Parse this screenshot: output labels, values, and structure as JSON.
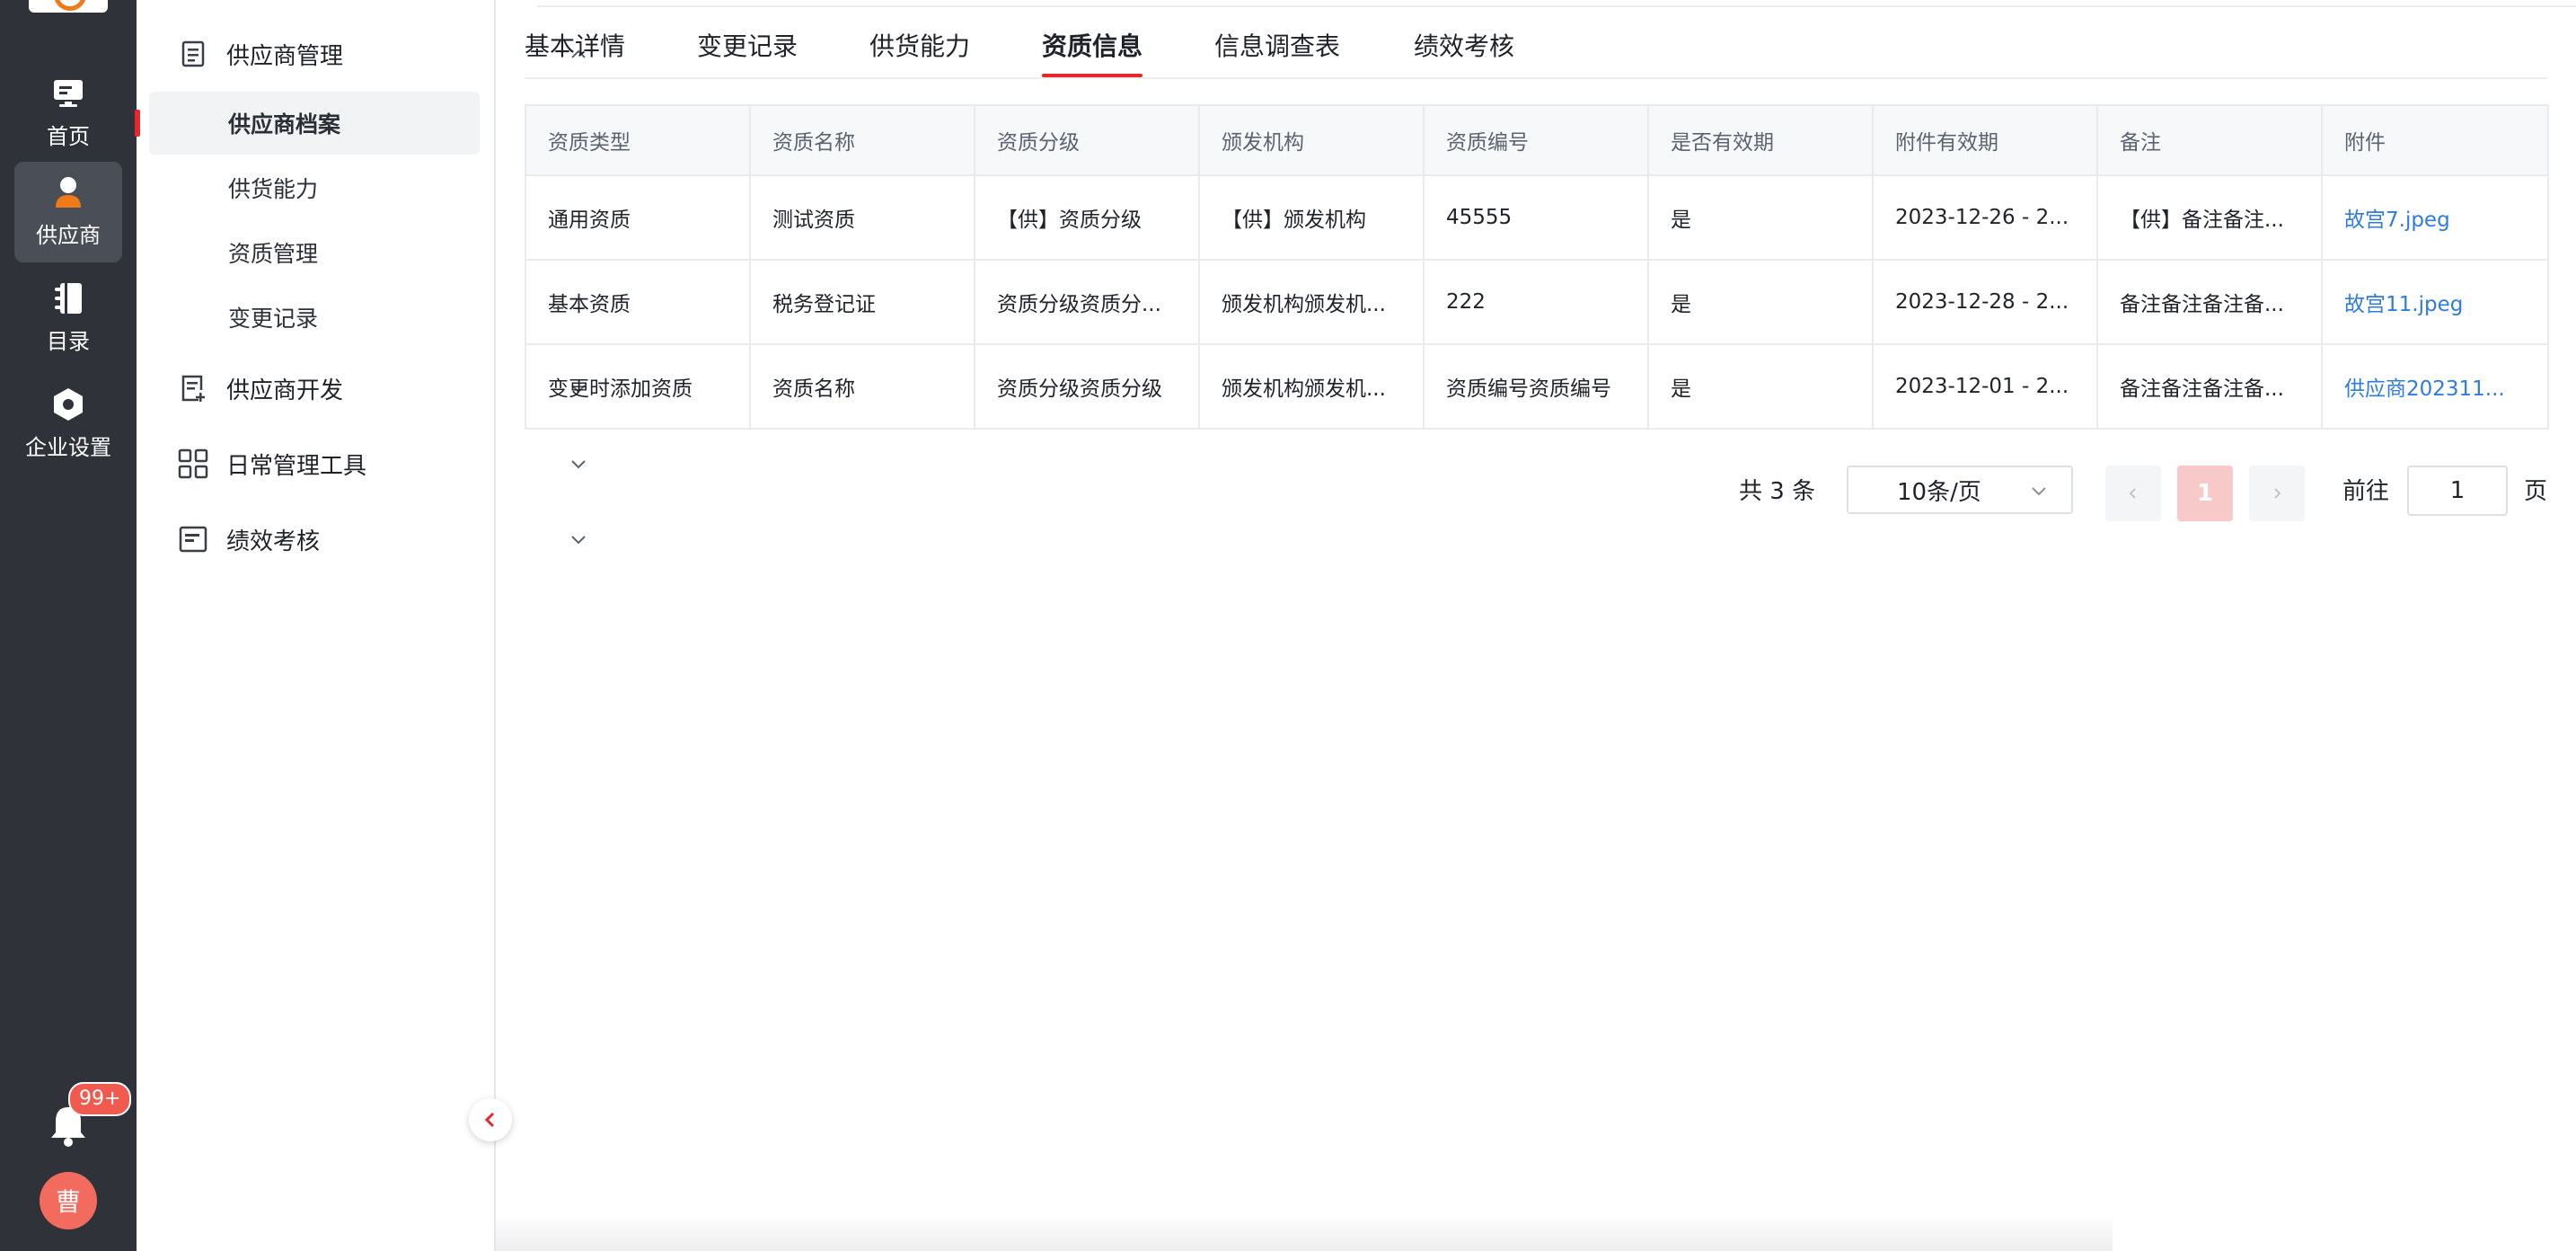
{
  "rail": {
    "items": [
      {
        "label": "首页",
        "icon": "monitor-icon"
      },
      {
        "label": "供应商",
        "icon": "person-icon"
      },
      {
        "label": "目录",
        "icon": "book-icon"
      },
      {
        "label": "企业设置",
        "icon": "gear-icon"
      }
    ],
    "notification_badge": "99+",
    "avatar_text": "曹"
  },
  "submenu": {
    "groups": [
      {
        "label": "供应商管理",
        "icon": "document-icon"
      },
      {
        "label": "供应商开发",
        "icon": "document-add-icon"
      },
      {
        "label": "日常管理工具",
        "icon": "grid-icon"
      },
      {
        "label": "绩效考核",
        "icon": "chart-card-icon"
      }
    ],
    "items": [
      "供应商档案",
      "供货能力",
      "资质管理",
      "变更记录"
    ]
  },
  "tabs": [
    "基本详情",
    "变更记录",
    "供货能力",
    "资质信息",
    "信息调查表",
    "绩效考核"
  ],
  "table": {
    "columns": [
      "资质类型",
      "资质名称",
      "资质分级",
      "颁发机构",
      "资质编号",
      "是否有效期",
      "附件有效期",
      "备注",
      "附件"
    ],
    "rows": [
      [
        "通用资质",
        "测试资质",
        "【供】资质分级",
        "【供】颁发机构",
        "45555",
        "是",
        "2023-12-26 - 2...",
        "【供】备注备注...",
        "故宫7.jpeg"
      ],
      [
        "基本资质",
        "税务登记证",
        "资质分级资质分...",
        "颁发机构颁发机...",
        "222",
        "是",
        "2023-12-28 - 2...",
        "备注备注备注备...",
        "故宫11.jpeg"
      ],
      [
        "变更时添加资质",
        "资质名称",
        "资质分级资质分级",
        "颁发机构颁发机...",
        "资质编号资质编号",
        "是",
        "2023-12-01 - 2...",
        "备注备注备注备...",
        "供应商202311..."
      ]
    ]
  },
  "pagination": {
    "total": "共 3 条",
    "page_size": "10条/页",
    "current_page": "1",
    "goto_label": "前往",
    "goto_value": "1",
    "page_suffix": "页"
  },
  "colors": {
    "accent": "#e6272d",
    "rail_bg": "#2f3239",
    "link": "#2f7ce0"
  }
}
